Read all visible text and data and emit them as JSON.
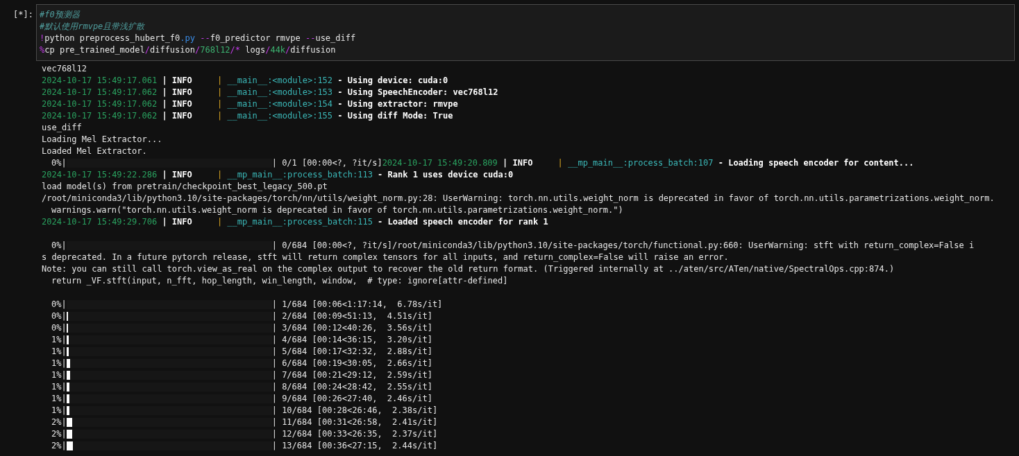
{
  "cell": {
    "prompt": "[*]:",
    "code_lines": [
      [
        {
          "text": "#f0预测器",
          "kind": "comment"
        }
      ],
      [
        {
          "text": "#默认使用rmvpe且带浅扩散",
          "kind": "comment"
        }
      ],
      [
        {
          "text": "!",
          "kind": "op"
        },
        {
          "text": "python preprocess_hubert_f0",
          "kind": "text"
        },
        {
          "text": ".py",
          "kind": "attr"
        },
        {
          "text": " --",
          "kind": "op"
        },
        {
          "text": "f0_predictor rmvpe ",
          "kind": "text"
        },
        {
          "text": "--",
          "kind": "op"
        },
        {
          "text": "use_diff",
          "kind": "text"
        }
      ],
      [
        {
          "text": "%",
          "kind": "op"
        },
        {
          "text": "cp pre_trained_model",
          "kind": "text"
        },
        {
          "text": "/",
          "kind": "op"
        },
        {
          "text": "diffusion",
          "kind": "text"
        },
        {
          "text": "/",
          "kind": "op"
        },
        {
          "text": "768l12",
          "kind": "num"
        },
        {
          "text": "/*",
          "kind": "op"
        },
        {
          "text": " logs",
          "kind": "text"
        },
        {
          "text": "/",
          "kind": "op"
        },
        {
          "text": "44k",
          "kind": "num"
        },
        {
          "text": "/",
          "kind": "op"
        },
        {
          "text": "diffusion",
          "kind": "text"
        }
      ]
    ]
  },
  "output": {
    "lines": [
      {
        "kind": "text",
        "segments": [
          {
            "text": "vec768l12",
            "kind": "plain"
          }
        ]
      },
      {
        "kind": "text",
        "segments": [
          {
            "text": "2024-10-17 15:49:17.061",
            "kind": "time"
          },
          {
            "text": " | ",
            "kind": "bold"
          },
          {
            "text": "INFO    ",
            "kind": "bold"
          },
          {
            "text": " | ",
            "kind": "sep"
          },
          {
            "text": "__main__:<module>:152",
            "kind": "module"
          },
          {
            "text": " - Using device: cuda:0",
            "kind": "bold"
          }
        ]
      },
      {
        "kind": "text",
        "segments": [
          {
            "text": "2024-10-17 15:49:17.062",
            "kind": "time"
          },
          {
            "text": " | ",
            "kind": "bold"
          },
          {
            "text": "INFO    ",
            "kind": "bold"
          },
          {
            "text": " | ",
            "kind": "sep"
          },
          {
            "text": "__main__:<module>:153",
            "kind": "module"
          },
          {
            "text": " - Using SpeechEncoder: vec768l12",
            "kind": "bold"
          }
        ]
      },
      {
        "kind": "text",
        "segments": [
          {
            "text": "2024-10-17 15:49:17.062",
            "kind": "time"
          },
          {
            "text": " | ",
            "kind": "bold"
          },
          {
            "text": "INFO    ",
            "kind": "bold"
          },
          {
            "text": " | ",
            "kind": "sep"
          },
          {
            "text": "__main__:<module>:154",
            "kind": "module"
          },
          {
            "text": " - Using extractor: rmvpe",
            "kind": "bold"
          }
        ]
      },
      {
        "kind": "text",
        "segments": [
          {
            "text": "2024-10-17 15:49:17.062",
            "kind": "time"
          },
          {
            "text": " | ",
            "kind": "bold"
          },
          {
            "text": "INFO    ",
            "kind": "bold"
          },
          {
            "text": " | ",
            "kind": "sep"
          },
          {
            "text": "__main__:<module>:155",
            "kind": "module"
          },
          {
            "text": " - Using diff Mode: True",
            "kind": "bold"
          }
        ]
      },
      {
        "kind": "text",
        "segments": [
          {
            "text": "use_diff",
            "kind": "plain"
          }
        ]
      },
      {
        "kind": "text",
        "segments": [
          {
            "text": "Loading Mel Extractor...",
            "kind": "plain"
          }
        ]
      },
      {
        "kind": "text",
        "segments": [
          {
            "text": "Loaded Mel Extractor.",
            "kind": "plain"
          }
        ]
      },
      {
        "kind": "progress",
        "percent": "0%|",
        "level": 0,
        "status": "| 0/1 [00:00<?, ?it/s]",
        "segments": [
          {
            "text": "2024-10-17 15:49:20.809",
            "kind": "time"
          },
          {
            "text": " | ",
            "kind": "bold"
          },
          {
            "text": "INFO    ",
            "kind": "bold"
          },
          {
            "text": " | ",
            "kind": "sep"
          },
          {
            "text": "__mp_main__:process_batch:107",
            "kind": "module"
          },
          {
            "text": " - Loading speech encoder for content...",
            "kind": "bold"
          }
        ]
      },
      {
        "kind": "text",
        "segments": [
          {
            "text": "2024-10-17 15:49:22.286",
            "kind": "time"
          },
          {
            "text": " | ",
            "kind": "bold"
          },
          {
            "text": "INFO    ",
            "kind": "bold"
          },
          {
            "text": " | ",
            "kind": "sep"
          },
          {
            "text": "__mp_main__:process_batch:113",
            "kind": "module"
          },
          {
            "text": " - Rank 1 uses device cuda:0",
            "kind": "bold"
          }
        ]
      },
      {
        "kind": "text",
        "segments": [
          {
            "text": "load model(s) from pretrain/checkpoint_best_legacy_500.pt",
            "kind": "plain"
          }
        ]
      },
      {
        "kind": "text",
        "segments": [
          {
            "text": "/root/miniconda3/lib/python3.10/site-packages/torch/nn/utils/weight_norm.py:28: UserWarning: torch.nn.utils.weight_norm is deprecated in favor of torch.nn.utils.parametrizations.weight_norm.",
            "kind": "plain"
          }
        ]
      },
      {
        "kind": "indented",
        "segments": [
          {
            "text": "warnings.warn(\"torch.nn.utils.weight_norm is deprecated in favor of torch.nn.utils.parametrizations.weight_norm.\")",
            "kind": "plain"
          }
        ]
      },
      {
        "kind": "text",
        "segments": [
          {
            "text": "2024-10-17 15:49:29.706",
            "kind": "time"
          },
          {
            "text": " | ",
            "kind": "bold"
          },
          {
            "text": "INFO    ",
            "kind": "bold"
          },
          {
            "text": " | ",
            "kind": "sep"
          },
          {
            "text": "__mp_main__:process_batch:115",
            "kind": "module"
          },
          {
            "text": " - Loaded speech encoder for rank 1",
            "kind": "bold"
          }
        ]
      },
      {
        "kind": "blank"
      },
      {
        "kind": "progress",
        "percent": "0%|",
        "level": 0,
        "status": "| 0/684 [00:00<?, ?it/s]",
        "segments": [
          {
            "text": "/root/miniconda3/lib/python3.10/site-packages/torch/functional.py:660: UserWarning: stft with return_complex=False i",
            "kind": "plain"
          }
        ]
      },
      {
        "kind": "text",
        "segments": [
          {
            "text": "s deprecated. In a future pytorch release, stft will return complex tensors for all inputs, and return_complex=False will raise an error.",
            "kind": "plain"
          }
        ]
      },
      {
        "kind": "text",
        "segments": [
          {
            "text": "Note: you can still call torch.view_as_real on the complex output to recover the old return format. (Triggered internally at ../aten/src/ATen/native/SpectralOps.cpp:874.)",
            "kind": "plain"
          }
        ]
      },
      {
        "kind": "indented",
        "segments": [
          {
            "text": "return _VF.stft(input, n_fft, hop_length, win_length, window,  # type: ignore[attr-defined]",
            "kind": "plain"
          }
        ]
      },
      {
        "kind": "blank"
      },
      {
        "kind": "progress",
        "percent": "0%|",
        "level": 0,
        "status": "| 1/684 [00:06<1:17:14,  6.78s/it]"
      },
      {
        "kind": "progress",
        "percent": "0%|",
        "level": 0.007,
        "status": "| 2/684 [00:09<51:13,  4.51s/it]"
      },
      {
        "kind": "progress",
        "percent": "0%|",
        "level": 0.007,
        "status": "| 3/684 [00:12<40:26,  3.56s/it]"
      },
      {
        "kind": "progress",
        "percent": "1%|",
        "level": 0.01,
        "status": "| 4/684 [00:14<36:15,  3.20s/it]"
      },
      {
        "kind": "progress",
        "percent": "1%|",
        "level": 0.01,
        "status": "| 5/684 [00:17<32:32,  2.88s/it]"
      },
      {
        "kind": "progress",
        "percent": "1%|",
        "level": 0.017,
        "status": "| 6/684 [00:19<30:05,  2.66s/it]"
      },
      {
        "kind": "progress",
        "percent": "1%|",
        "level": 0.017,
        "status": "| 7/684 [00:21<29:12,  2.59s/it]"
      },
      {
        "kind": "progress",
        "percent": "1%|",
        "level": 0.014,
        "status": "| 8/684 [00:24<28:42,  2.55s/it]"
      },
      {
        "kind": "progress",
        "percent": "1%|",
        "level": 0.014,
        "status": "| 9/684 [00:26<27:40,  2.46s/it]"
      },
      {
        "kind": "progress",
        "percent": "1%|",
        "level": 0.014,
        "status": "| 10/684 [00:28<26:46,  2.38s/it]"
      },
      {
        "kind": "progress",
        "percent": "2%|",
        "level": 0.027,
        "status": "| 11/684 [00:31<26:58,  2.41s/it]"
      },
      {
        "kind": "progress",
        "percent": "2%|",
        "level": 0.027,
        "status": "| 12/684 [00:33<26:35,  2.37s/it]"
      },
      {
        "kind": "progress",
        "percent": "2%|",
        "level": 0.03,
        "status": "| 13/684 [00:36<27:15,  2.44s/it]"
      }
    ]
  }
}
